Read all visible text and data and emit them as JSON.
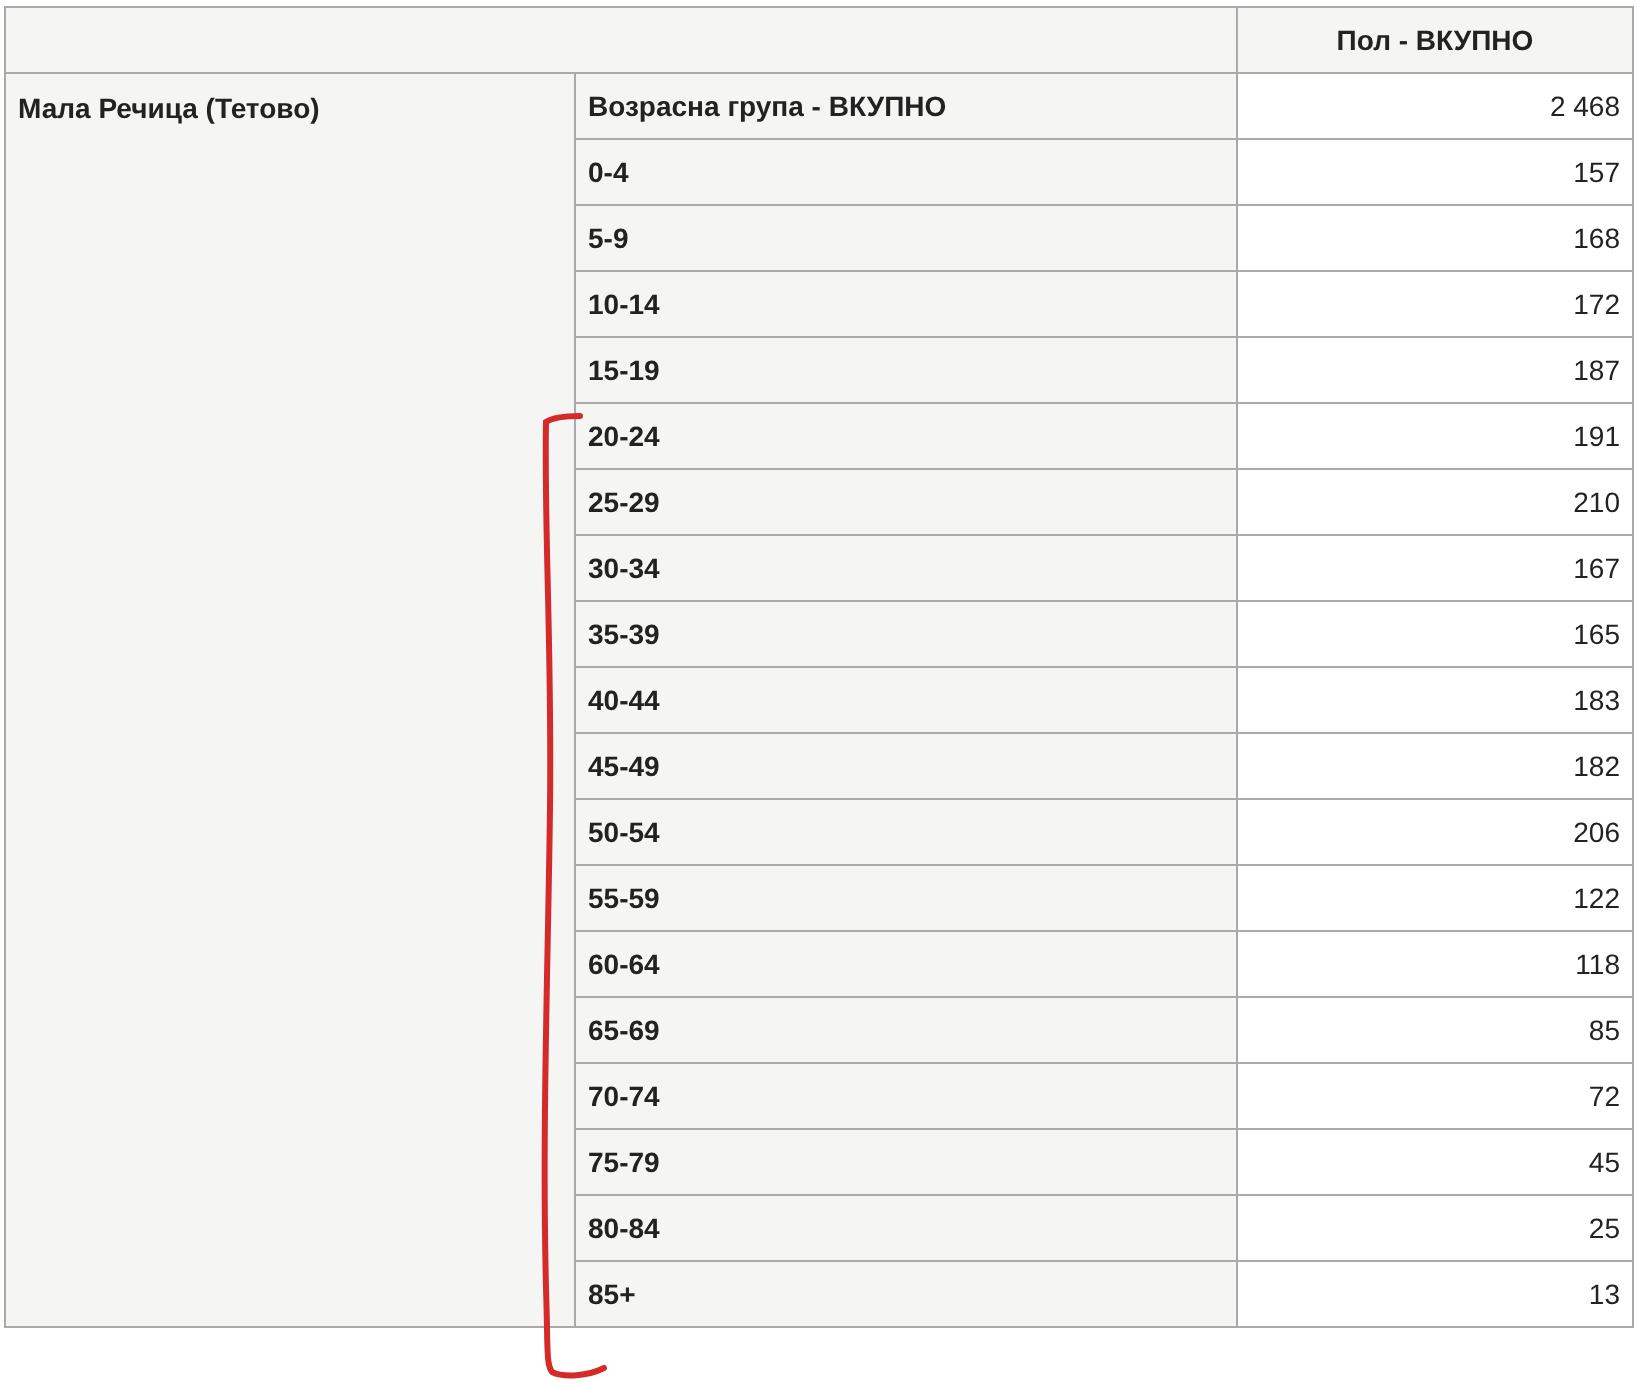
{
  "table": {
    "column_header": "Пол - ВКУПНО",
    "row_group": "Мала Речица (Тетово)",
    "rows": [
      {
        "label": "Возрасна група - ВКУПНО",
        "value": "2 468"
      },
      {
        "label": "0-4",
        "value": "157"
      },
      {
        "label": "5-9",
        "value": "168"
      },
      {
        "label": "10-14",
        "value": "172"
      },
      {
        "label": "15-19",
        "value": "187"
      },
      {
        "label": "20-24",
        "value": "191"
      },
      {
        "label": "25-29",
        "value": "210"
      },
      {
        "label": "30-34",
        "value": "167"
      },
      {
        "label": "35-39",
        "value": "165"
      },
      {
        "label": "40-44",
        "value": "183"
      },
      {
        "label": "45-49",
        "value": "182"
      },
      {
        "label": "50-54",
        "value": "206"
      },
      {
        "label": "55-59",
        "value": "122"
      },
      {
        "label": "60-64",
        "value": "118"
      },
      {
        "label": "65-69",
        "value": "85"
      },
      {
        "label": "70-74",
        "value": "72"
      },
      {
        "label": "75-79",
        "value": "45"
      },
      {
        "label": "80-84",
        "value": "25"
      },
      {
        "label": "85+",
        "value": "13"
      }
    ]
  }
}
